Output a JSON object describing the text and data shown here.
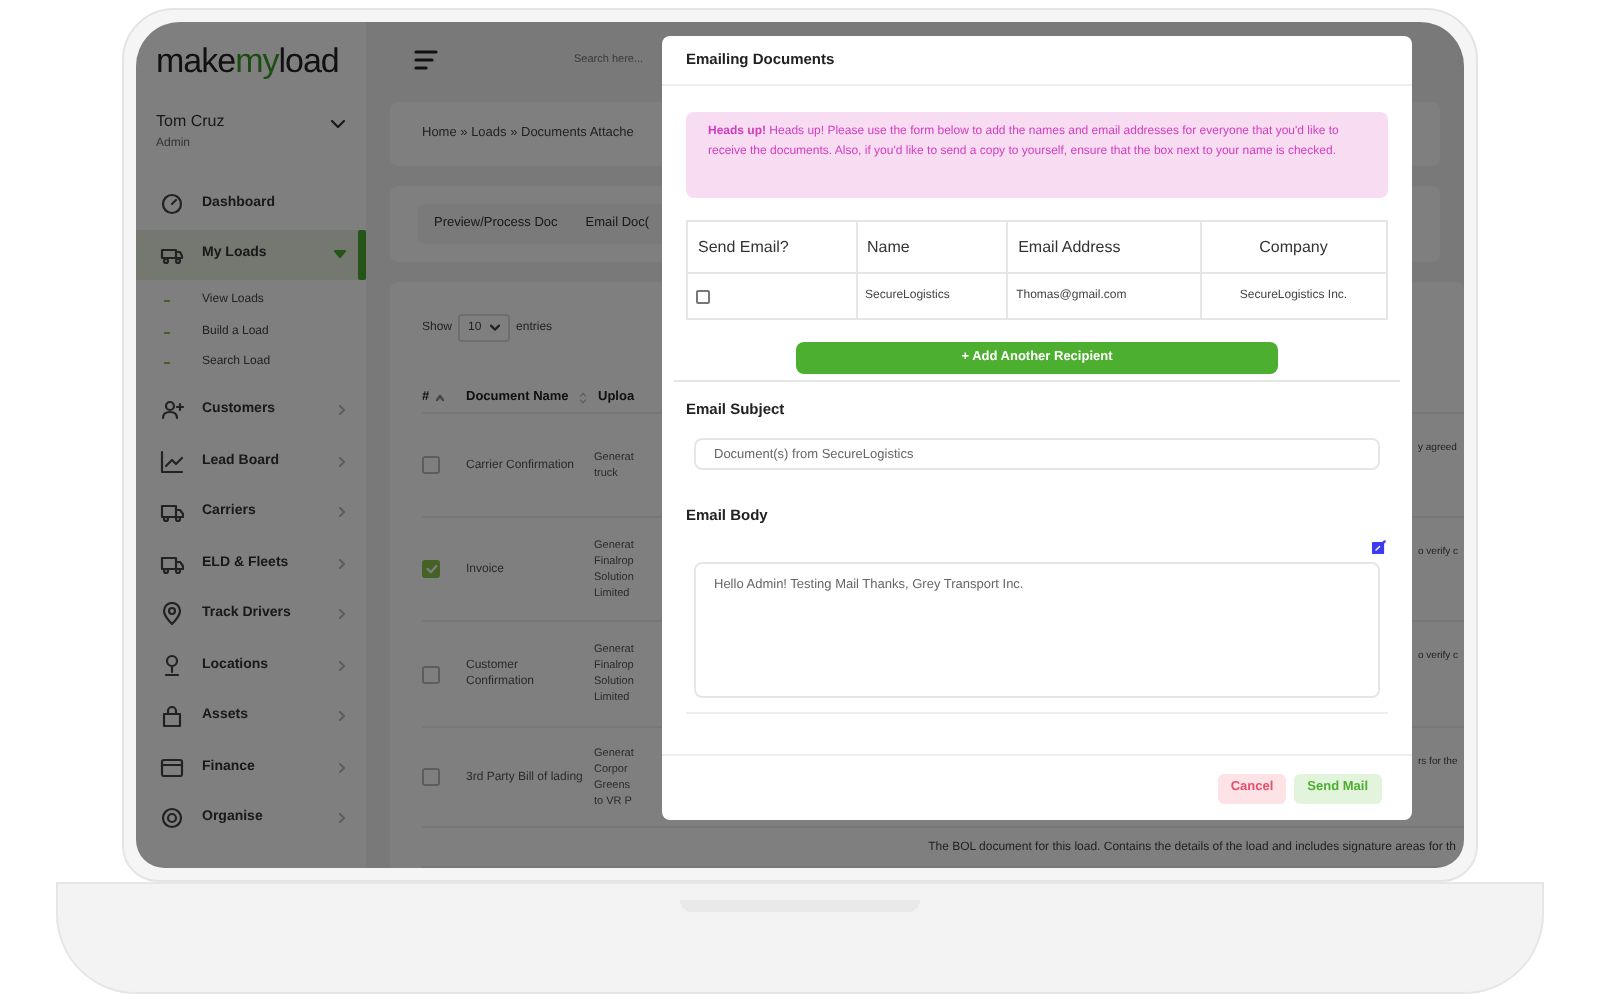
{
  "brand": {
    "logo_start": "make",
    "logo_accent": "my",
    "logo_end": "load"
  },
  "user": {
    "name": "Tom Cruz",
    "role": "Admin"
  },
  "header": {
    "search": {
      "placeholder": "Search here..."
    }
  },
  "sidebar": {
    "items": [
      {
        "label": "Dashboard",
        "kind": "link",
        "selected": false,
        "expanded": false
      },
      {
        "label": "My Loads",
        "kind": "menu",
        "selected": true,
        "expanded": true,
        "children": [
          {
            "label": "View Loads"
          },
          {
            "label": "Build a Load"
          },
          {
            "label": "Search Load"
          }
        ]
      },
      {
        "label": "Customers",
        "kind": "menu",
        "selected": false,
        "expanded": false
      },
      {
        "label": "Lead Board",
        "kind": "menu",
        "selected": false,
        "expanded": false
      },
      {
        "label": "Carriers",
        "kind": "menu",
        "selected": false,
        "expanded": false
      },
      {
        "label": "ELD & Fleets",
        "kind": "menu",
        "selected": false,
        "expanded": false
      },
      {
        "label": "Track Drivers",
        "kind": "menu",
        "selected": false,
        "expanded": false
      },
      {
        "label": "Locations",
        "kind": "menu",
        "selected": false,
        "expanded": false
      },
      {
        "label": "Assets",
        "kind": "menu",
        "selected": false,
        "expanded": false
      },
      {
        "label": "Finance",
        "kind": "menu",
        "selected": false,
        "expanded": false
      },
      {
        "label": "Organise",
        "kind": "menu",
        "selected": false,
        "expanded": false
      }
    ]
  },
  "breadcrumb": "Home » Loads » Documents Attache",
  "doc_actions": [
    "Preview/Process Doc",
    "Email Doc("
  ],
  "entries": {
    "show": "Show",
    "page_size": "10",
    "suffix": "entries"
  },
  "documents": {
    "columns": [
      "#",
      "Document Name",
      "Uploa"
    ],
    "rows": [
      {
        "checked": false,
        "name": "Carrier Confirmation",
        "column_3": [
          "Generat",
          "truck"
        ],
        "column_4": "y agreed"
      },
      {
        "checked": true,
        "name": "Invoice",
        "column_3": [
          "Generat",
          "Finalrop",
          "Solution",
          "Limited"
        ],
        "column_4": "o verify c"
      },
      {
        "checked": false,
        "name": "Customer Confirmation",
        "column_3": [
          "Generat",
          "Finalrop",
          "Solution",
          "Limited"
        ],
        "column_4": "o verify c"
      },
      {
        "checked": false,
        "name": "3rd Party Bill of lading",
        "column_3": [
          "Generat",
          "Corpor",
          "Greens",
          "to VR P"
        ],
        "column_4": "rs for the"
      },
      {
        "column_4": "The BOL document for this load. Contains the details of the load and includes signature areas for th"
      }
    ]
  },
  "modal": {
    "title": "Emailing Documents",
    "alert": "**Heads up!** Heads up! Please use the form below to add the names and email addresses for everyone that you'd like to receive the documents. Also, if you'd like to send a copy to yourself, ensure that the box next to your name is checked.",
    "recipients": {
      "columns": [
        "Send Email?",
        "Name",
        "Email Address",
        "Company"
      ],
      "rows": [
        {
          "checked": false,
          "name": "SecureLogistics",
          "email": "Thomas@gmail.com",
          "company": "SecureLogistics Inc."
        }
      ]
    },
    "add_button": "+ Add Another Recipient",
    "subject_label": "Email Subject",
    "subject_value": "Document(s) from SecureLogistics",
    "body_label": "Email Body",
    "body_value": "Hello Admin! Testing Mail Thanks, Grey Transport Inc.",
    "cancel_button": "Cancel",
    "send_button": "Send Mail"
  }
}
